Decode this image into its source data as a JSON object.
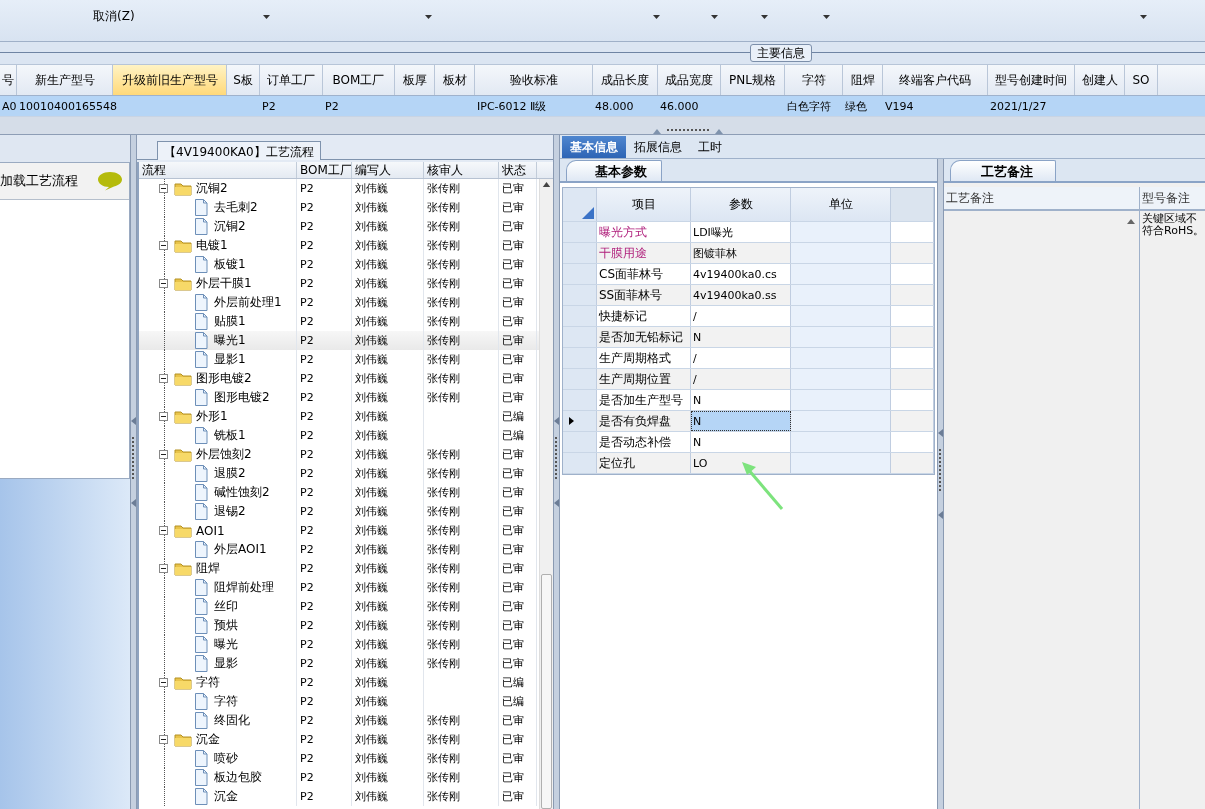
{
  "toolbar": {
    "items": [
      {
        "label": "取消(Z)"
      }
    ]
  },
  "main_info": {
    "title": "主要信息",
    "columns": [
      {
        "label": "号",
        "highlighted": false
      },
      {
        "label": "新生产型号",
        "highlighted": false
      },
      {
        "label": "升级前旧生产型号",
        "highlighted": true
      },
      {
        "label": "S板",
        "highlighted": false
      },
      {
        "label": "订单工厂",
        "highlighted": false
      },
      {
        "label": "BOM工厂",
        "highlighted": false
      },
      {
        "label": "板厚",
        "highlighted": false
      },
      {
        "label": "板材",
        "highlighted": false
      },
      {
        "label": "验收标准",
        "highlighted": false
      },
      {
        "label": "成品长度",
        "highlighted": false
      },
      {
        "label": "成品宽度",
        "highlighted": false
      },
      {
        "label": "PNL规格",
        "highlighted": false
      },
      {
        "label": "字符",
        "highlighted": false
      },
      {
        "label": "阻焊",
        "highlighted": false
      },
      {
        "label": "终端客户代码",
        "highlighted": false
      },
      {
        "label": "型号创建时间",
        "highlighted": false
      },
      {
        "label": "创建人",
        "highlighted": false
      },
      {
        "label": "SO",
        "highlighted": false
      }
    ],
    "rows": [
      {
        "selected": true,
        "cells": [
          "A0",
          "10010400165548",
          null,
          null,
          "P2",
          "P2",
          null,
          null,
          "IPC-6012 Ⅱ级",
          "48.000",
          "46.000",
          null,
          "白色字符",
          "绿色",
          "V194",
          "2021/1/27",
          null,
          null
        ]
      }
    ]
  },
  "load_panel": {
    "title": "加载工艺流程"
  },
  "process_flow": {
    "title": "【4V19400KA0】工艺流程",
    "columns": [
      "流程",
      "BOM工厂",
      "编写人",
      "核审人",
      "状态"
    ],
    "nodes": [
      {
        "name": "沉铜2",
        "bom": "P2",
        "author": "刘伟巍",
        "reviewer": "张传刚",
        "status": "已审",
        "expanded": true,
        "selected": false,
        "children": [
          {
            "name": "去毛刺2",
            "bom": "P2",
            "author": "刘伟巍",
            "reviewer": "张传刚",
            "status": "已审",
            "selected": false
          },
          {
            "name": "沉铜2",
            "bom": "P2",
            "author": "刘伟巍",
            "reviewer": "张传刚",
            "status": "已审",
            "selected": false
          }
        ]
      },
      {
        "name": "电镀1",
        "bom": "P2",
        "author": "刘伟巍",
        "reviewer": "张传刚",
        "status": "已审",
        "expanded": true,
        "selected": false,
        "children": [
          {
            "name": "板镀1",
            "bom": "P2",
            "author": "刘伟巍",
            "reviewer": "张传刚",
            "status": "已审",
            "selected": false
          }
        ]
      },
      {
        "name": "外层干膜1",
        "bom": "P2",
        "author": "刘伟巍",
        "reviewer": "张传刚",
        "status": "已审",
        "expanded": true,
        "selected": false,
        "children": [
          {
            "name": "外层前处理1",
            "bom": "P2",
            "author": "刘伟巍",
            "reviewer": "张传刚",
            "status": "已审",
            "selected": false
          },
          {
            "name": "贴膜1",
            "bom": "P2",
            "author": "刘伟巍",
            "reviewer": "张传刚",
            "status": "已审",
            "selected": false
          },
          {
            "name": "曝光1",
            "bom": "P2",
            "author": "刘伟巍",
            "reviewer": "张传刚",
            "status": "已审",
            "selected": true
          },
          {
            "name": "显影1",
            "bom": "P2",
            "author": "刘伟巍",
            "reviewer": "张传刚",
            "status": "已审",
            "selected": false
          }
        ]
      },
      {
        "name": "图形电镀2",
        "bom": "P2",
        "author": "刘伟巍",
        "reviewer": "张传刚",
        "status": "已审",
        "expanded": true,
        "selected": false,
        "children": [
          {
            "name": "图形电镀2",
            "bom": "P2",
            "author": "刘伟巍",
            "reviewer": "张传刚",
            "status": "已审",
            "selected": false
          }
        ]
      },
      {
        "name": "外形1",
        "bom": "P2",
        "author": "刘伟巍",
        "status": "已编",
        "expanded": true,
        "selected": false,
        "children": [
          {
            "name": "铣板1",
            "bom": "P2",
            "author": "刘伟巍",
            "status": "已编",
            "selected": false
          }
        ]
      },
      {
        "name": "外层蚀刻2",
        "bom": "P2",
        "author": "刘伟巍",
        "reviewer": "张传刚",
        "status": "已审",
        "expanded": true,
        "selected": false,
        "children": [
          {
            "name": "退膜2",
            "bom": "P2",
            "author": "刘伟巍",
            "reviewer": "张传刚",
            "status": "已审",
            "selected": false
          },
          {
            "name": "碱性蚀刻2",
            "bom": "P2",
            "author": "刘伟巍",
            "reviewer": "张传刚",
            "status": "已审",
            "selected": false
          },
          {
            "name": "退锡2",
            "bom": "P2",
            "author": "刘伟巍",
            "reviewer": "张传刚",
            "status": "已审",
            "selected": false
          }
        ]
      },
      {
        "name": "AOI1",
        "bom": "P2",
        "author": "刘伟巍",
        "reviewer": "张传刚",
        "status": "已审",
        "expanded": true,
        "selected": false,
        "children": [
          {
            "name": "外层AOI1",
            "bom": "P2",
            "author": "刘伟巍",
            "reviewer": "张传刚",
            "status": "已审",
            "selected": false
          }
        ]
      },
      {
        "name": "阻焊",
        "bom": "P2",
        "author": "刘伟巍",
        "reviewer": "张传刚",
        "status": "已审",
        "expanded": true,
        "selected": false,
        "children": [
          {
            "name": "阻焊前处理",
            "bom": "P2",
            "author": "刘伟巍",
            "reviewer": "张传刚",
            "status": "已审",
            "selected": false
          },
          {
            "name": "丝印",
            "bom": "P2",
            "author": "刘伟巍",
            "reviewer": "张传刚",
            "status": "已审",
            "selected": false
          },
          {
            "name": "预烘",
            "bom": "P2",
            "author": "刘伟巍",
            "reviewer": "张传刚",
            "status": "已审",
            "selected": false
          },
          {
            "name": "曝光",
            "bom": "P2",
            "author": "刘伟巍",
            "reviewer": "张传刚",
            "status": "已审",
            "selected": false
          },
          {
            "name": "显影",
            "bom": "P2",
            "author": "刘伟巍",
            "reviewer": "张传刚",
            "status": "已审",
            "selected": false
          }
        ]
      },
      {
        "name": "字符",
        "bom": "P2",
        "author": "刘伟巍",
        "status": "已编",
        "expanded": true,
        "selected": false,
        "children": [
          {
            "name": "字符",
            "bom": "P2",
            "author": "刘伟巍",
            "status": "已编",
            "selected": false
          },
          {
            "name": "终固化",
            "bom": "P2",
            "author": "刘伟巍",
            "reviewer": "张传刚",
            "status": "已审",
            "selected": false
          }
        ]
      },
      {
        "name": "沉金",
        "bom": "P2",
        "author": "刘伟巍",
        "reviewer": "张传刚",
        "status": "已审",
        "expanded": true,
        "selected": false,
        "children": [
          {
            "name": "喷砂",
            "bom": "P2",
            "author": "刘伟巍",
            "reviewer": "张传刚",
            "status": "已审",
            "selected": false
          },
          {
            "name": "板边包胶",
            "bom": "P2",
            "author": "刘伟巍",
            "reviewer": "张传刚",
            "status": "已审",
            "selected": false
          },
          {
            "name": "沉金",
            "bom": "P2",
            "author": "刘伟巍",
            "reviewer": "张传刚",
            "status": "已审",
            "selected": false
          }
        ]
      }
    ]
  },
  "detail": {
    "tabs": [
      {
        "label": "基本信息",
        "selected": true
      },
      {
        "label": "拓展信息",
        "selected": false
      },
      {
        "label": "工时",
        "selected": false
      }
    ],
    "params": {
      "tab": "基本参数",
      "columns": [
        "项目",
        "参数",
        "单位"
      ],
      "rows": [
        {
          "item": "曝光方式",
          "value": "LDI曝光",
          "required": true,
          "selected": false
        },
        {
          "item": "干膜用途",
          "value": "图镀菲林",
          "required": true,
          "selected": false
        },
        {
          "item": "CS面菲林号",
          "value": "4v19400ka0.cs",
          "required": false,
          "selected": false
        },
        {
          "item": "SS面菲林号",
          "value": "4v19400ka0.ss",
          "required": false,
          "selected": false
        },
        {
          "item": "快捷标记",
          "value": "/",
          "required": false,
          "selected": false
        },
        {
          "item": "是否加无铅标记",
          "value": "N",
          "required": false,
          "selected": false
        },
        {
          "item": "生产周期格式",
          "value": "/",
          "required": false,
          "selected": false
        },
        {
          "item": "生产周期位置",
          "value": "/",
          "required": false,
          "selected": false
        },
        {
          "item": "是否加生产型号",
          "value": "N",
          "required": false,
          "selected": false
        },
        {
          "item": "是否有负焊盘",
          "value": "N",
          "required": false,
          "selected": true
        },
        {
          "item": "是否动态补偿",
          "value": "N",
          "required": false,
          "selected": false
        },
        {
          "item": "定位孔",
          "value": "LO",
          "required": false,
          "selected": false
        }
      ]
    },
    "notes": {
      "tab": "工艺备注",
      "columns": [
        "工艺备注",
        "型号备注"
      ],
      "model_note_lines": [
        "关键区域不",
        "符合RoHS。"
      ]
    }
  }
}
